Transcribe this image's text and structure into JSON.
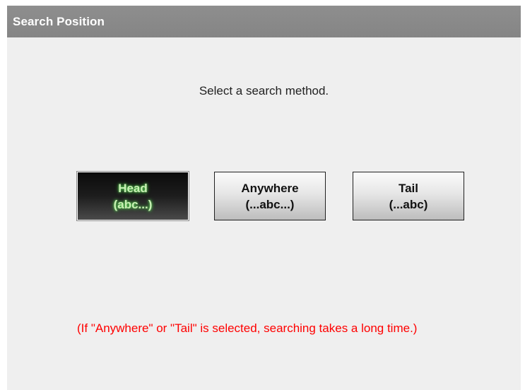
{
  "dialog": {
    "title": "Search Position"
  },
  "prompt": "Select a search method.",
  "buttons": [
    {
      "line1": "Head",
      "line2": "(abc...)",
      "selected": true
    },
    {
      "line1": "Anywhere",
      "line2": "(...abc...)",
      "selected": false
    },
    {
      "line1": "Tail",
      "line2": "(...abc)",
      "selected": false
    }
  ],
  "warning": "(If \"Anywhere\" or \"Tail\" is selected, searching takes a long time.)",
  "colors": {
    "title_bar": "#858585",
    "background": "#efefef",
    "selected_text": "#c8f0b4",
    "warning_text": "#ff0000"
  }
}
